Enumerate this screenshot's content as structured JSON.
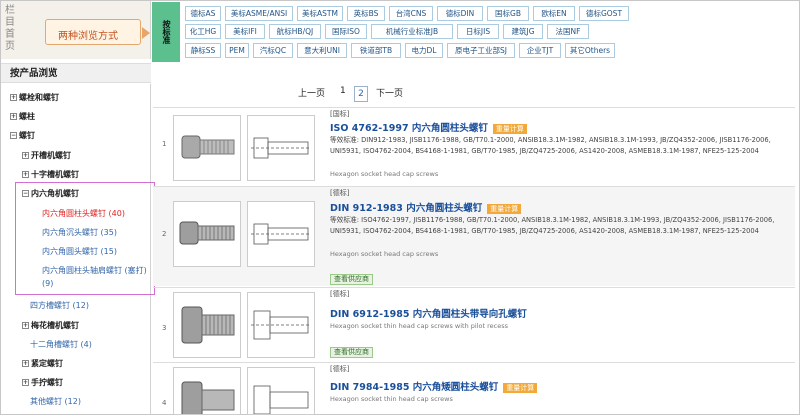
{
  "header": {
    "vertical_title": "栏目首页",
    "mode_label": "两种浏览方式"
  },
  "standards": {
    "label": "按标准",
    "tabs": [
      [
        "德标AS",
        "美标ASME/ANSI",
        "美标ASTM",
        "英标BS",
        "台湾CNS",
        "德标DIN",
        "国标GB",
        "欧标EN",
        "德标GOST"
      ],
      [
        "化工HG",
        "美标IFI",
        "航标HB/QJ",
        "国际ISO",
        "机械行业标准JB",
        "日标JIS",
        "建筑JG",
        "法国NF"
      ],
      [
        "静标SS",
        "PEM",
        "汽标QC",
        "意大利UNI",
        "铁道部TB",
        "电力DL",
        "原电子工业部SJ",
        "企业TJT",
        "其它Others"
      ]
    ]
  },
  "sidebar": {
    "title": "按产品浏览",
    "items": [
      {
        "label": "螺栓和螺钉",
        "type": "parent"
      },
      {
        "label": "螺柱",
        "type": "parent"
      },
      {
        "label": "螺钉",
        "type": "parent-open"
      },
      {
        "label": "开槽机螺钉",
        "type": "parent"
      },
      {
        "label": "十字槽机螺钉",
        "type": "parent"
      },
      {
        "label": "内六角机螺钉",
        "type": "parent-open"
      },
      {
        "label": "内六角圆柱头螺钉 (40)",
        "type": "active"
      },
      {
        "label": "内六角沉头螺钉 (35)",
        "type": "link"
      },
      {
        "label": "内六角圆头螺钉 (15)",
        "type": "link"
      },
      {
        "label": "内六角圆柱头轴肩螺钉 (塞打)",
        "type": "link"
      },
      {
        "label": "(9)",
        "type": "link"
      },
      {
        "label": "四方槽螺钉 (12)",
        "type": "link"
      },
      {
        "label": "梅花槽机螺钉",
        "type": "parent"
      },
      {
        "label": "十二角槽螺钉 (4)",
        "type": "link"
      },
      {
        "label": "紧定螺钉",
        "type": "parent"
      },
      {
        "label": "手拧螺钉",
        "type": "parent"
      },
      {
        "label": "其他螺钉 (12)",
        "type": "link"
      }
    ]
  },
  "pager": {
    "prev": "上一页",
    "page1": "1",
    "page2": "2",
    "next": "下一页"
  },
  "products": [
    {
      "num": "1",
      "tag": "[国标]",
      "title": "ISO 4762-1997 内六角圆柱头螺钉",
      "badge": "重量计算",
      "equiv": "等效标准: DIN912-1983, JISB1176-1988, GB/T70.1-2000, ANSIB18.3.1M-1982, ANSIB18.3.1M-1993, JB/ZQ4352-2006, JISB1176-2006, UNI5931, ISO4762-2004, BS4168-1-1981, GB/T70-1985, JB/ZQ4725-2006, AS1420-2008, ASMEB18.3.1M-1987, NFE25-125-2004",
      "sub": "Hexagon socket head cap screws",
      "supply": ""
    },
    {
      "num": "2",
      "tag": "[德标]",
      "title": "DIN 912-1983 内六角圆柱头螺钉",
      "badge": "重量计算",
      "equiv": "等效标准: ISO4762-1997, JISB1176-1988, GB/T70.1-2000, ANSIB18.3.1M-1982, ANSIB18.3.1M-1993, JB/ZQ4352-2006, JISB1176-2006, UNI5931, ISO4762-2004, BS4168-1-1981, GB/T70-1985, JB/ZQ4725-2006, AS1420-2008, ASMEB18.3.1M-1987, NFE25-125-2004",
      "sub": "Hexagon socket head cap screws",
      "supply": "查看供应商"
    },
    {
      "num": "3",
      "tag": "[德标]",
      "title": "DIN 6912-1985 内六角圆柱头带导向孔螺钉",
      "badge": "",
      "equiv": "",
      "sub": "Hexagon socket thin head cap screws with pilot recess",
      "supply": "查看供应商"
    },
    {
      "num": "4",
      "tag": "[德标]",
      "title": "DIN 7984-1985 内六角矮圆柱头螺钉",
      "badge": "重量计算",
      "equiv": "",
      "sub": "Hexagon socket thin head cap screws",
      "supply": ""
    }
  ]
}
